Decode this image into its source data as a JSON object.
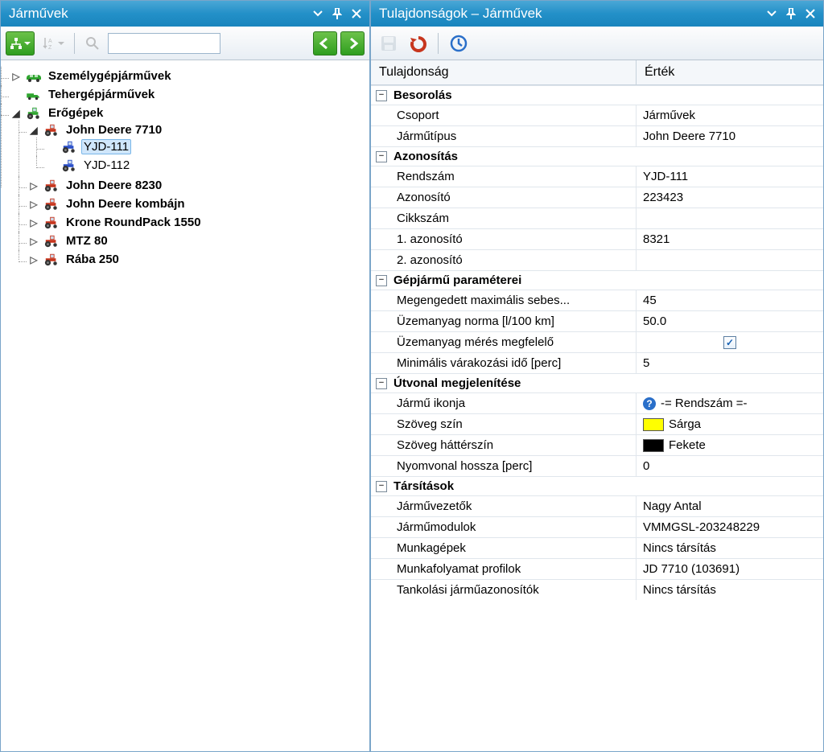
{
  "left_panel": {
    "title": "Járművek",
    "toolbar": {
      "tree_btn": "tree",
      "sort_btn": "A-Z",
      "search_placeholder": ""
    },
    "tree": [
      {
        "id": "szemely",
        "label": "Személygépjárművek",
        "icon": "car-green",
        "expanded": false,
        "bold": true,
        "children_placeholder": true
      },
      {
        "id": "teher",
        "label": "Tehergépjárművek",
        "icon": "truck-green",
        "expanded": false,
        "bold": true,
        "leaf": true
      },
      {
        "id": "erogepek",
        "label": "Erőgépek",
        "icon": "tractor-green",
        "expanded": true,
        "bold": true,
        "children": [
          {
            "id": "jd7710",
            "label": "John Deere 7710",
            "icon": "tractor-red",
            "expanded": true,
            "bold": true,
            "children": [
              {
                "id": "yjd111",
                "label": "YJD-111",
                "icon": "tractor-blue",
                "selected": true,
                "leaf": true
              },
              {
                "id": "yjd112",
                "label": "YJD-112",
                "icon": "tractor-blue",
                "leaf": true
              }
            ]
          },
          {
            "id": "jd8230",
            "label": "John Deere 8230",
            "icon": "tractor-red",
            "bold": true,
            "expanded": false,
            "children_placeholder": true
          },
          {
            "id": "jdkombajn",
            "label": "John Deere kombájn",
            "icon": "tractor-red",
            "bold": true,
            "expanded": false,
            "children_placeholder": true
          },
          {
            "id": "krone",
            "label": "Krone RoundPack 1550",
            "icon": "tractor-red",
            "bold": true,
            "expanded": false,
            "children_placeholder": true
          },
          {
            "id": "mtz80",
            "label": "MTZ 80",
            "icon": "tractor-red",
            "bold": true,
            "expanded": false,
            "children_placeholder": true
          },
          {
            "id": "raba250",
            "label": "Rába 250",
            "icon": "tractor-red",
            "bold": true,
            "expanded": false,
            "children_placeholder": true
          }
        ]
      }
    ]
  },
  "right_panel": {
    "title": "Tulajdonságok – Járművek",
    "toolbar": {
      "save": "save",
      "revert": "revert",
      "history": "history"
    },
    "headers": {
      "property": "Tulajdonság",
      "value": "Érték"
    },
    "categories": [
      {
        "name": "Besorolás",
        "rows": [
          {
            "label": "Csoport",
            "value": "Járművek"
          },
          {
            "label": "Járműtípus",
            "value": "John Deere 7710"
          }
        ]
      },
      {
        "name": "Azonosítás",
        "rows": [
          {
            "label": "Rendszám",
            "value": "YJD-111"
          },
          {
            "label": "Azonosító",
            "value": "223423"
          },
          {
            "label": "Cikkszám",
            "value": ""
          },
          {
            "label": "1. azonosító",
            "value": "8321"
          },
          {
            "label": "2. azonosító",
            "value": ""
          }
        ]
      },
      {
        "name": "Gépjármű paraméterei",
        "rows": [
          {
            "label": "Megengedett maximális sebes...",
            "value": "45"
          },
          {
            "label": "Üzemanyag norma [l/100 km]",
            "value": "50.0"
          },
          {
            "label": "Üzemanyag mérés megfelelő",
            "type": "checkbox",
            "checked": true
          },
          {
            "label": "Minimális várakozási idő [perc]",
            "value": "5"
          }
        ]
      },
      {
        "name": "Útvonal megjelenítése",
        "rows": [
          {
            "label": "Jármű ikonja",
            "type": "iconref",
            "value": "-= Rendszám =-"
          },
          {
            "label": "Szöveg szín",
            "type": "color",
            "swatch": "yellow",
            "value": "Sárga"
          },
          {
            "label": "Szöveg háttérszín",
            "type": "color",
            "swatch": "black",
            "value": "Fekete"
          },
          {
            "label": "Nyomvonal hossza [perc]",
            "value": "0"
          }
        ]
      },
      {
        "name": "Társítások",
        "rows": [
          {
            "label": "Járművezetők",
            "value": "Nagy Antal"
          },
          {
            "label": "Járműmodulok",
            "value": "VMMGSL-203248229"
          },
          {
            "label": "Munkagépek",
            "value": "Nincs társítás"
          },
          {
            "label": "Munkafolyamat profilok",
            "value": "JD 7710 (103691)"
          },
          {
            "label": "Tankolási járműazonosítók",
            "value": "Nincs társítás"
          }
        ]
      }
    ]
  }
}
